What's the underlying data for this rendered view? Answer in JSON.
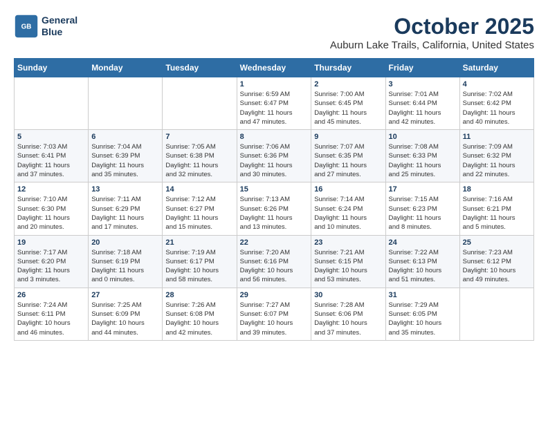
{
  "header": {
    "logo": {
      "line1": "General",
      "line2": "Blue"
    },
    "title": "October 2025",
    "location": "Auburn Lake Trails, California, United States"
  },
  "weekdays": [
    "Sunday",
    "Monday",
    "Tuesday",
    "Wednesday",
    "Thursday",
    "Friday",
    "Saturday"
  ],
  "weeks": [
    [
      {
        "day": "",
        "info": ""
      },
      {
        "day": "",
        "info": ""
      },
      {
        "day": "",
        "info": ""
      },
      {
        "day": "1",
        "info": "Sunrise: 6:59 AM\nSunset: 6:47 PM\nDaylight: 11 hours\nand 47 minutes."
      },
      {
        "day": "2",
        "info": "Sunrise: 7:00 AM\nSunset: 6:45 PM\nDaylight: 11 hours\nand 45 minutes."
      },
      {
        "day": "3",
        "info": "Sunrise: 7:01 AM\nSunset: 6:44 PM\nDaylight: 11 hours\nand 42 minutes."
      },
      {
        "day": "4",
        "info": "Sunrise: 7:02 AM\nSunset: 6:42 PM\nDaylight: 11 hours\nand 40 minutes."
      }
    ],
    [
      {
        "day": "5",
        "info": "Sunrise: 7:03 AM\nSunset: 6:41 PM\nDaylight: 11 hours\nand 37 minutes."
      },
      {
        "day": "6",
        "info": "Sunrise: 7:04 AM\nSunset: 6:39 PM\nDaylight: 11 hours\nand 35 minutes."
      },
      {
        "day": "7",
        "info": "Sunrise: 7:05 AM\nSunset: 6:38 PM\nDaylight: 11 hours\nand 32 minutes."
      },
      {
        "day": "8",
        "info": "Sunrise: 7:06 AM\nSunset: 6:36 PM\nDaylight: 11 hours\nand 30 minutes."
      },
      {
        "day": "9",
        "info": "Sunrise: 7:07 AM\nSunset: 6:35 PM\nDaylight: 11 hours\nand 27 minutes."
      },
      {
        "day": "10",
        "info": "Sunrise: 7:08 AM\nSunset: 6:33 PM\nDaylight: 11 hours\nand 25 minutes."
      },
      {
        "day": "11",
        "info": "Sunrise: 7:09 AM\nSunset: 6:32 PM\nDaylight: 11 hours\nand 22 minutes."
      }
    ],
    [
      {
        "day": "12",
        "info": "Sunrise: 7:10 AM\nSunset: 6:30 PM\nDaylight: 11 hours\nand 20 minutes."
      },
      {
        "day": "13",
        "info": "Sunrise: 7:11 AM\nSunset: 6:29 PM\nDaylight: 11 hours\nand 17 minutes."
      },
      {
        "day": "14",
        "info": "Sunrise: 7:12 AM\nSunset: 6:27 PM\nDaylight: 11 hours\nand 15 minutes."
      },
      {
        "day": "15",
        "info": "Sunrise: 7:13 AM\nSunset: 6:26 PM\nDaylight: 11 hours\nand 13 minutes."
      },
      {
        "day": "16",
        "info": "Sunrise: 7:14 AM\nSunset: 6:24 PM\nDaylight: 11 hours\nand 10 minutes."
      },
      {
        "day": "17",
        "info": "Sunrise: 7:15 AM\nSunset: 6:23 PM\nDaylight: 11 hours\nand 8 minutes."
      },
      {
        "day": "18",
        "info": "Sunrise: 7:16 AM\nSunset: 6:21 PM\nDaylight: 11 hours\nand 5 minutes."
      }
    ],
    [
      {
        "day": "19",
        "info": "Sunrise: 7:17 AM\nSunset: 6:20 PM\nDaylight: 11 hours\nand 3 minutes."
      },
      {
        "day": "20",
        "info": "Sunrise: 7:18 AM\nSunset: 6:19 PM\nDaylight: 11 hours\nand 0 minutes."
      },
      {
        "day": "21",
        "info": "Sunrise: 7:19 AM\nSunset: 6:17 PM\nDaylight: 10 hours\nand 58 minutes."
      },
      {
        "day": "22",
        "info": "Sunrise: 7:20 AM\nSunset: 6:16 PM\nDaylight: 10 hours\nand 56 minutes."
      },
      {
        "day": "23",
        "info": "Sunrise: 7:21 AM\nSunset: 6:15 PM\nDaylight: 10 hours\nand 53 minutes."
      },
      {
        "day": "24",
        "info": "Sunrise: 7:22 AM\nSunset: 6:13 PM\nDaylight: 10 hours\nand 51 minutes."
      },
      {
        "day": "25",
        "info": "Sunrise: 7:23 AM\nSunset: 6:12 PM\nDaylight: 10 hours\nand 49 minutes."
      }
    ],
    [
      {
        "day": "26",
        "info": "Sunrise: 7:24 AM\nSunset: 6:11 PM\nDaylight: 10 hours\nand 46 minutes."
      },
      {
        "day": "27",
        "info": "Sunrise: 7:25 AM\nSunset: 6:09 PM\nDaylight: 10 hours\nand 44 minutes."
      },
      {
        "day": "28",
        "info": "Sunrise: 7:26 AM\nSunset: 6:08 PM\nDaylight: 10 hours\nand 42 minutes."
      },
      {
        "day": "29",
        "info": "Sunrise: 7:27 AM\nSunset: 6:07 PM\nDaylight: 10 hours\nand 39 minutes."
      },
      {
        "day": "30",
        "info": "Sunrise: 7:28 AM\nSunset: 6:06 PM\nDaylight: 10 hours\nand 37 minutes."
      },
      {
        "day": "31",
        "info": "Sunrise: 7:29 AM\nSunset: 6:05 PM\nDaylight: 10 hours\nand 35 minutes."
      },
      {
        "day": "",
        "info": ""
      }
    ]
  ]
}
